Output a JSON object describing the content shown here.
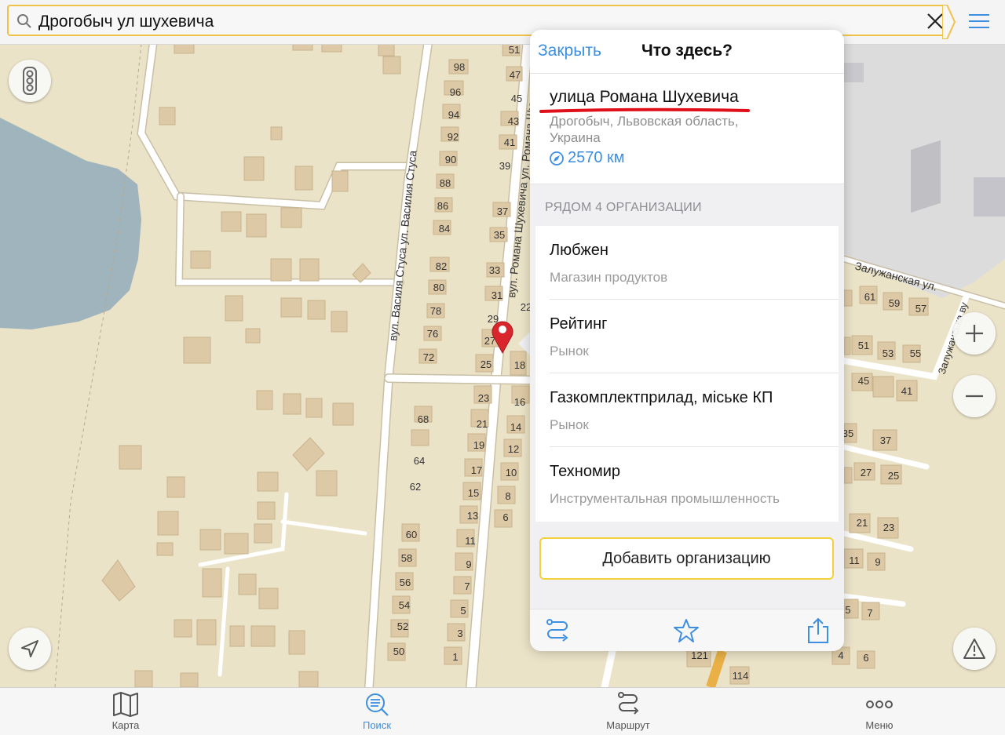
{
  "search": {
    "query": "Дрогобыч ул шухевича"
  },
  "map": {
    "street_labels": {
      "stusa": "вул. Василя Стуса ул. Василия Стуса",
      "shukhevycha": "вул. Романа Шухевича ул. Романа Шухевича",
      "zaluzhanska": "Залужанская ул.",
      "zaluzhanska_v": "Залужанська ву"
    },
    "house_numbers": {
      "a": [
        "51",
        "47",
        "45",
        "43",
        "41",
        "39",
        "37",
        "35",
        "33",
        "31",
        "29",
        "27",
        "25"
      ],
      "b": [
        "98",
        "96",
        "94",
        "92",
        "90",
        "88",
        "86",
        "84",
        "82",
        "80",
        "78",
        "76",
        "72"
      ],
      "c": [
        "68",
        "64",
        "62",
        "60",
        "58",
        "56",
        "54",
        "52",
        "50"
      ],
      "d": [
        "23",
        "21",
        "19",
        "17",
        "15",
        "13",
        "11",
        "9",
        "7",
        "5",
        "3",
        "1"
      ],
      "e": [
        "22",
        "18",
        "16",
        "14",
        "12",
        "10",
        "8",
        "6"
      ],
      "f": [
        "61",
        "59",
        "57",
        "51",
        "53",
        "55",
        "45",
        "41",
        "35",
        "37",
        "27",
        "25",
        "21",
        "23",
        "11",
        "9",
        "5",
        "7",
        "4",
        "6",
        "121",
        "114"
      ]
    }
  },
  "popover": {
    "close_label": "Закрыть",
    "title": "Что здесь?",
    "street": "улица Романа Шухевича",
    "city": "Дрогобыч, Львовская область, Украина",
    "distance": "2570 км",
    "nearby_header": "РЯДОМ 4 ОРГАНИЗАЦИИ",
    "organizations": [
      {
        "name": "Любжен",
        "type": "Магазин продуктов"
      },
      {
        "name": "Рейтинг",
        "type": "Рынок"
      },
      {
        "name": "Газкомплектприлад, міське КП",
        "type": "Рынок"
      },
      {
        "name": "Техномир",
        "type": "Инструментальная промышленность"
      }
    ],
    "add_org_label": "Добавить организацию",
    "actions": [
      "route-icon",
      "star-icon",
      "share-icon"
    ]
  },
  "tabs": [
    {
      "label": "Карта",
      "icon": "map-icon",
      "active": false
    },
    {
      "label": "Поиск",
      "icon": "search-icon",
      "active": true
    },
    {
      "label": "Маршрут",
      "icon": "route-icon",
      "active": false
    },
    {
      "label": "Меню",
      "icon": "more-icon",
      "active": false
    }
  ],
  "colors": {
    "accent": "#3d8fe0",
    "search_border": "#f0c24a",
    "marker": "#d9262c",
    "underline": "#e0101a",
    "map_ground": "#ece4c9",
    "water": "#9fb4bc",
    "building": "#ddc9a5"
  }
}
